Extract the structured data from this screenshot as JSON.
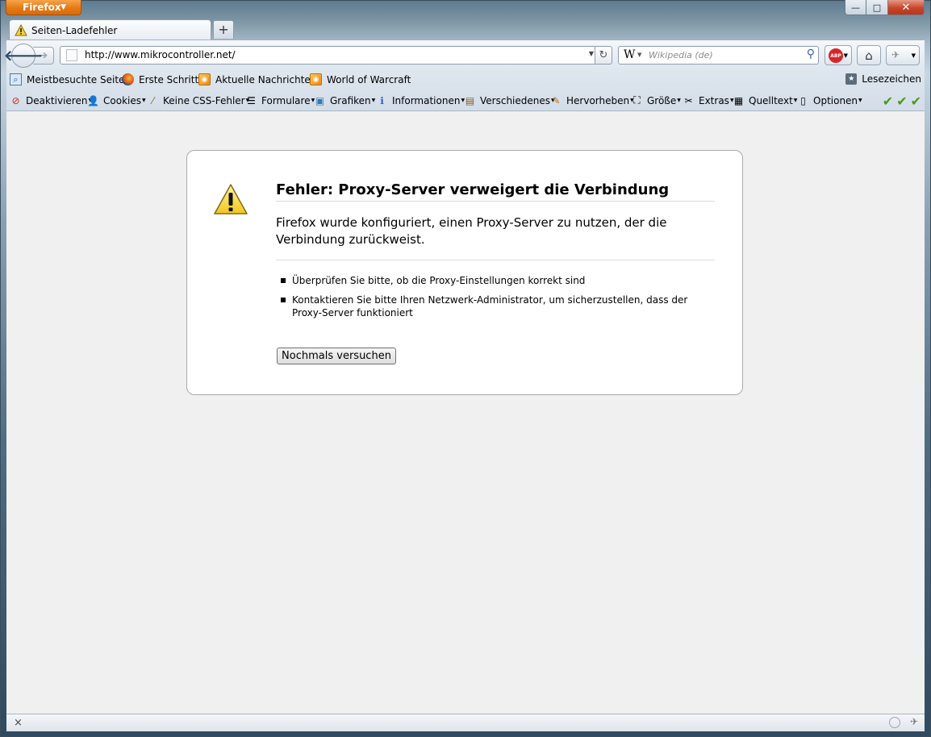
{
  "window": {
    "menu_button_label": "Firefox",
    "min_label": "—",
    "max_label": "□",
    "close_label": "✕"
  },
  "tab": {
    "title": "Seiten-Ladefehler",
    "new_tab_label": "+"
  },
  "navigation": {
    "url": "http://www.mikrocontroller.net/",
    "search_engine_glyph": "W",
    "search_placeholder": "Wikipedia (de)",
    "abp_label": "ABP"
  },
  "bookmarks": {
    "items": [
      {
        "label": "Meistbesuchte Seiten",
        "icon": "most-visited-icon"
      },
      {
        "label": "Erste Schritte",
        "icon": "firefox-icon"
      },
      {
        "label": "Aktuelle Nachrichten",
        "icon": "rss-icon"
      },
      {
        "label": "World of Warcraft",
        "icon": "rss-icon"
      }
    ],
    "right_label": "Lesezeichen"
  },
  "devtoolbar": {
    "items": [
      {
        "label": "Deaktivieren",
        "icon": "disable-icon"
      },
      {
        "label": "Cookies",
        "icon": "user-icon"
      },
      {
        "label": "Keine CSS-Fehler",
        "icon": "wand-icon"
      },
      {
        "label": "Formulare",
        "icon": "form-icon"
      },
      {
        "label": "Grafiken",
        "icon": "image-icon"
      },
      {
        "label": "Informationen",
        "icon": "info-icon"
      },
      {
        "label": "Verschiedenes",
        "icon": "misc-icon"
      },
      {
        "label": "Hervorheben",
        "icon": "pencil-icon"
      },
      {
        "label": "Größe",
        "icon": "resize-icon"
      },
      {
        "label": "Extras",
        "icon": "tools-icon"
      },
      {
        "label": "Quelltext",
        "icon": "source-icon"
      },
      {
        "label": "Optionen",
        "icon": "options-icon"
      }
    ],
    "status_checks": 3
  },
  "error": {
    "title": "Fehler: Proxy-Server verweigert die Verbindung",
    "description": "Firefox wurde konfiguriert, einen Proxy-Server zu nutzen, der die Verbindung zurückweist.",
    "bullets": [
      "Überprüfen Sie bitte, ob die Proxy-Einstellungen korrekt sind",
      "Kontaktieren Sie bitte Ihren Netzwerk-Administrator, um sicherzustellen, dass der Proxy-Server funktioniert"
    ],
    "retry_label": "Nochmals versuchen"
  },
  "statusbar": {
    "close_label": "×"
  }
}
